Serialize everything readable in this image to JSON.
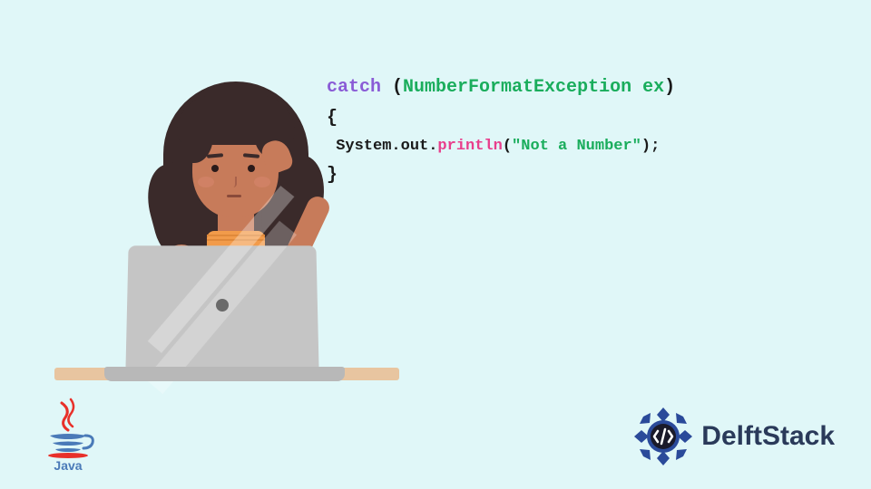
{
  "code": {
    "line1": {
      "catch": "catch ",
      "paren_open": "(",
      "type": "NumberFormatException ex",
      "paren_close": ")"
    },
    "brace_open": "{",
    "line2": {
      "prefix": "System.out.",
      "method": "println",
      "paren_open": "(",
      "string": "\"Not a Number\"",
      "paren_close": ");"
    },
    "brace_close": "}"
  },
  "logos": {
    "java": "Java",
    "delft": "DelftStack"
  }
}
